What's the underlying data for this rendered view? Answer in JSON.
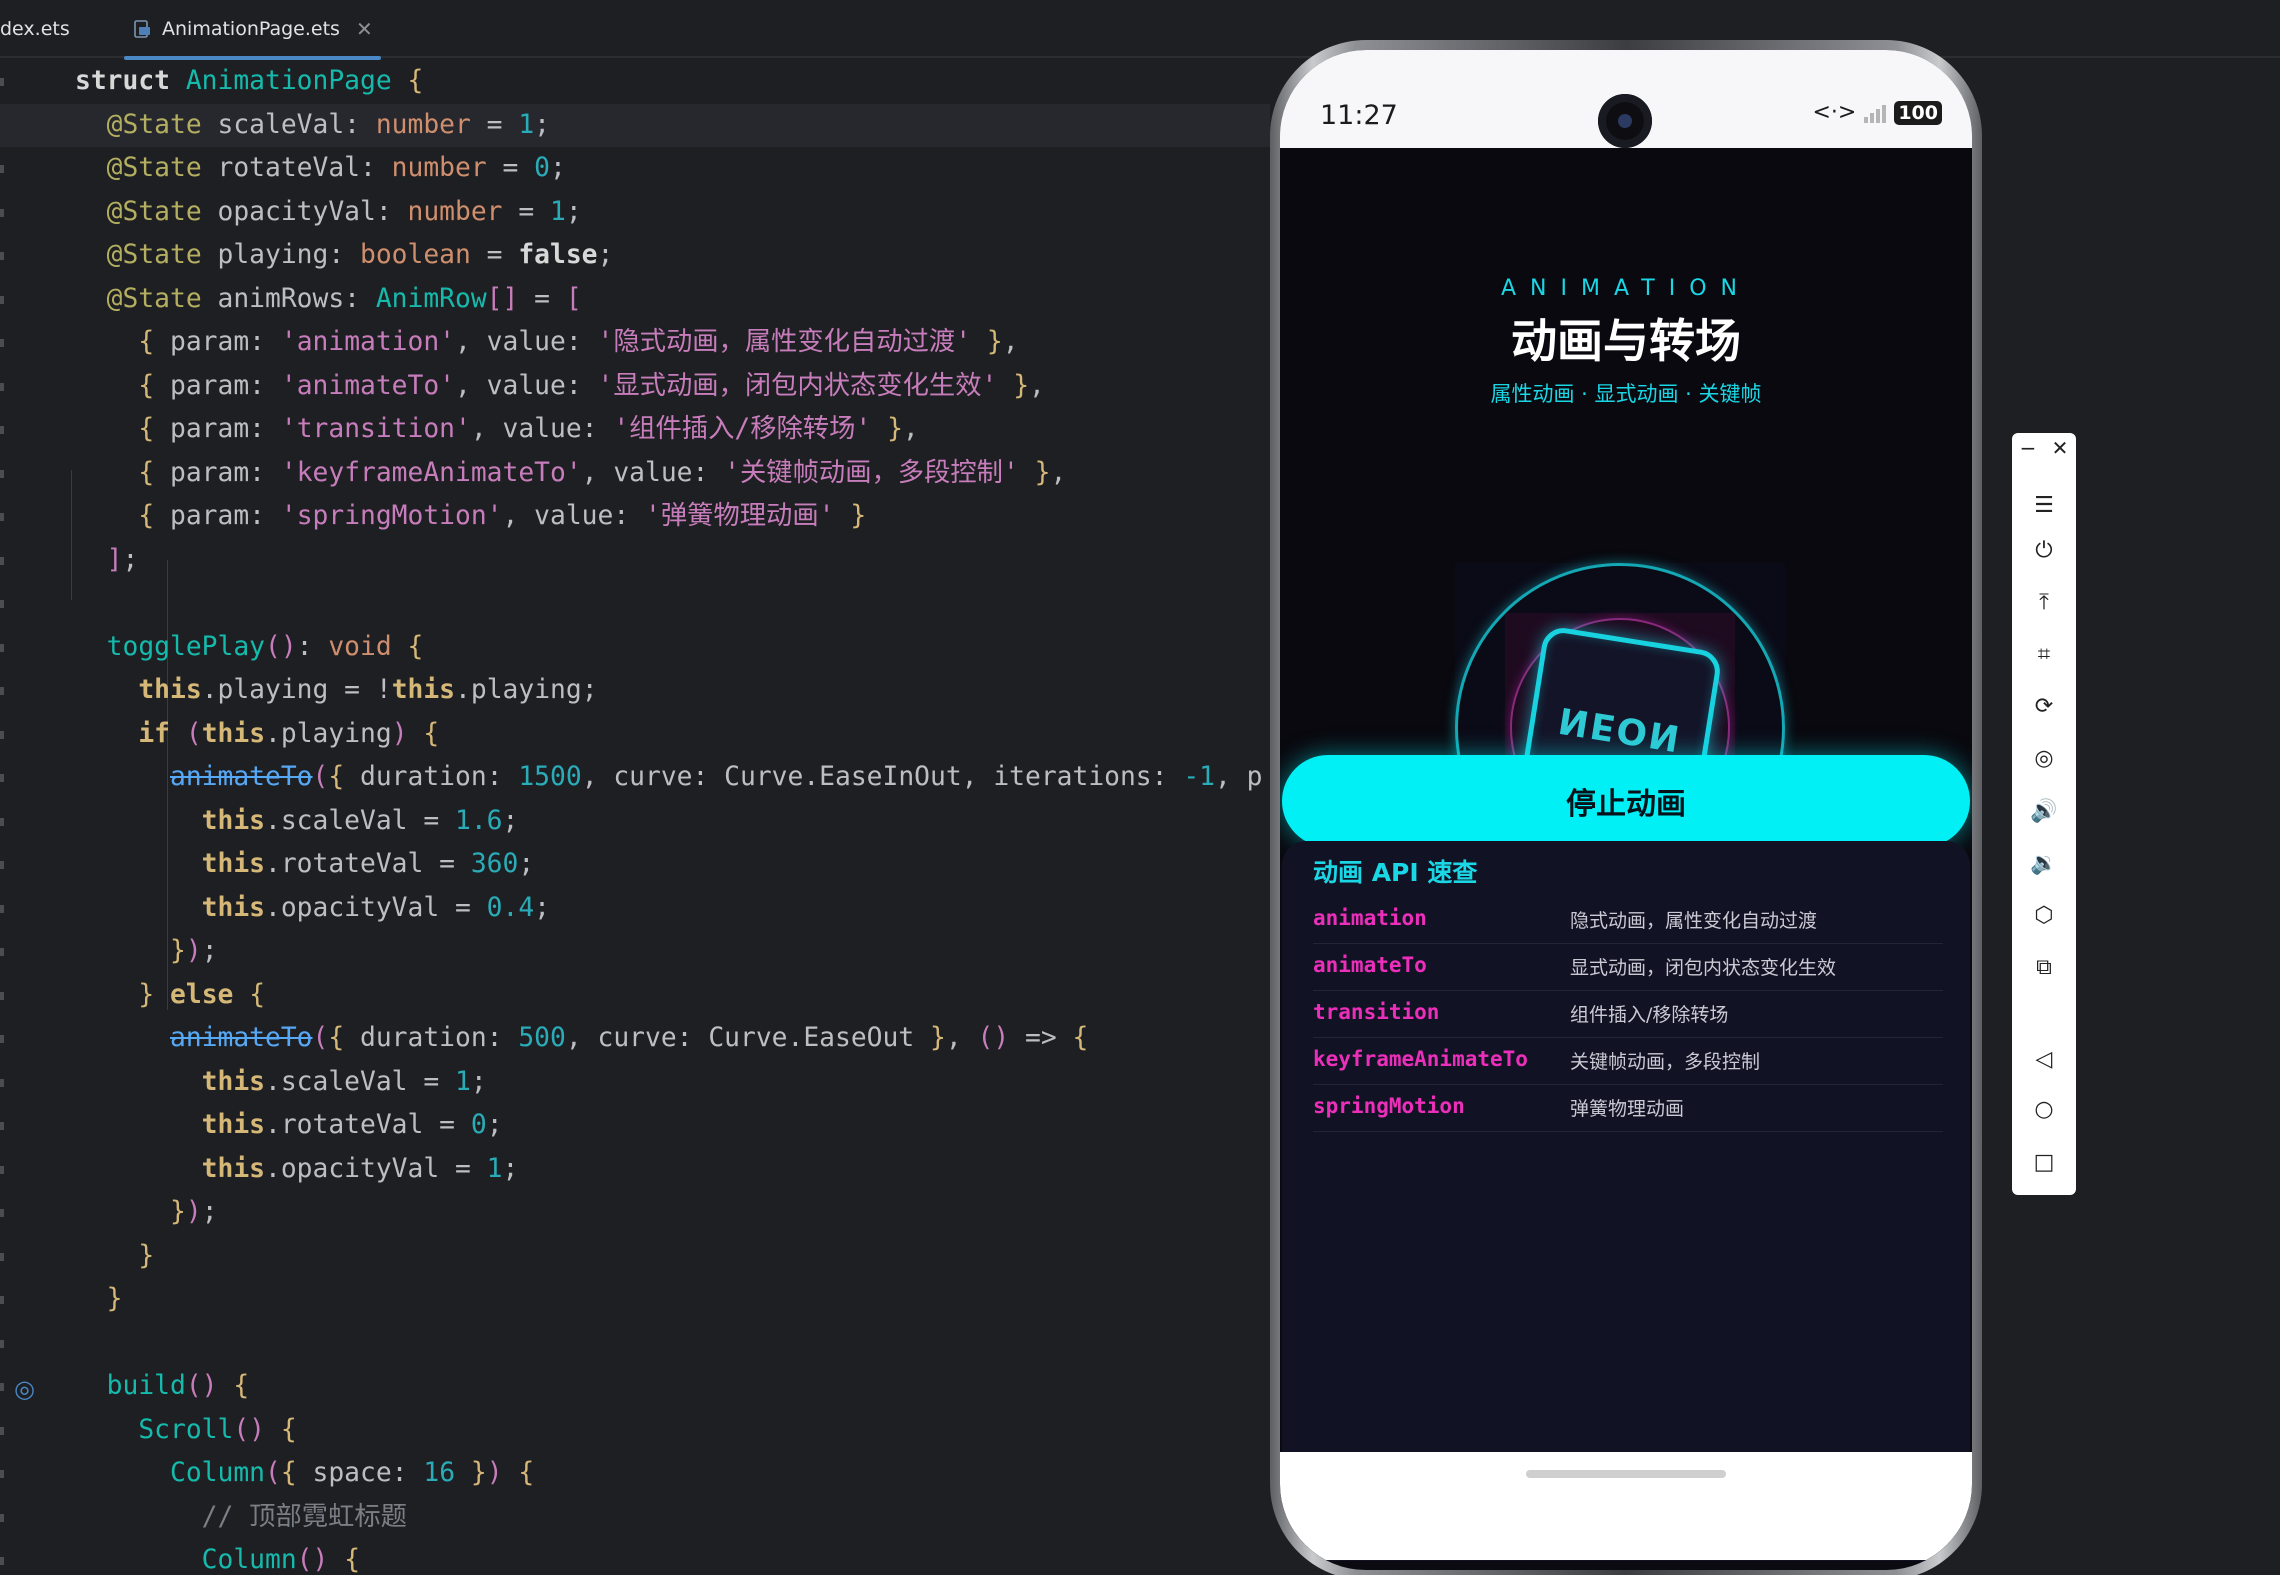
{
  "tabs": [
    {
      "label": "dex.ets",
      "active": false
    },
    {
      "label": "AnimationPage.ets",
      "active": true
    }
  ],
  "code": {
    "lines": [
      {
        "spans": [
          [
            "sw",
            "struct "
          ],
          [
            "cl",
            "AnimationPage "
          ],
          [
            "brk1",
            "{"
          ]
        ]
      },
      {
        "spans": [
          [
            "txt",
            "  "
          ],
          [
            "ann",
            "@State "
          ],
          [
            "txt",
            "scaleVal: "
          ],
          [
            "kw",
            "number"
          ],
          [
            "txt",
            " = "
          ],
          [
            "num",
            "1"
          ],
          [
            "txt",
            ";"
          ]
        ],
        "active": true
      },
      {
        "spans": [
          [
            "txt",
            "  "
          ],
          [
            "ann",
            "@State "
          ],
          [
            "txt",
            "rotateVal: "
          ],
          [
            "kw",
            "number"
          ],
          [
            "txt",
            " = "
          ],
          [
            "num",
            "0"
          ],
          [
            "txt",
            ";"
          ]
        ]
      },
      {
        "spans": [
          [
            "txt",
            "  "
          ],
          [
            "ann",
            "@State "
          ],
          [
            "txt",
            "opacityVal: "
          ],
          [
            "kw",
            "number"
          ],
          [
            "txt",
            " = "
          ],
          [
            "num",
            "1"
          ],
          [
            "txt",
            ";"
          ]
        ]
      },
      {
        "spans": [
          [
            "txt",
            "  "
          ],
          [
            "ann",
            "@State "
          ],
          [
            "txt",
            "playing: "
          ],
          [
            "kw",
            "boolean"
          ],
          [
            "txt",
            " = "
          ],
          [
            "sw",
            "false"
          ],
          [
            "txt",
            ";"
          ]
        ]
      },
      {
        "spans": [
          [
            "txt",
            "  "
          ],
          [
            "ann",
            "@State "
          ],
          [
            "txt",
            "animRows: "
          ],
          [
            "cl",
            "AnimRow"
          ],
          [
            "brk2",
            "[]"
          ],
          [
            "txt",
            " = "
          ],
          [
            "brk2",
            "["
          ]
        ]
      },
      {
        "spans": [
          [
            "txt",
            "    "
          ],
          [
            "brk1",
            "{"
          ],
          [
            "txt",
            " param: "
          ],
          [
            "str",
            "'animation'"
          ],
          [
            "txt",
            ", value: "
          ],
          [
            "str",
            "'隐式动画，属性变化自动过渡'"
          ],
          [
            "txt",
            " "
          ],
          [
            "brk1",
            "}"
          ],
          [
            "txt",
            ","
          ]
        ]
      },
      {
        "spans": [
          [
            "txt",
            "    "
          ],
          [
            "brk1",
            "{"
          ],
          [
            "txt",
            " param: "
          ],
          [
            "str",
            "'animateTo'"
          ],
          [
            "txt",
            ", value: "
          ],
          [
            "str",
            "'显式动画，闭包内状态变化生效'"
          ],
          [
            "txt",
            " "
          ],
          [
            "brk1",
            "}"
          ],
          [
            "txt",
            ","
          ]
        ]
      },
      {
        "spans": [
          [
            "txt",
            "    "
          ],
          [
            "brk1",
            "{"
          ],
          [
            "txt",
            " param: "
          ],
          [
            "str",
            "'transition'"
          ],
          [
            "txt",
            ", value: "
          ],
          [
            "str",
            "'组件插入/移除转场'"
          ],
          [
            "txt",
            " "
          ],
          [
            "brk1",
            "}"
          ],
          [
            "txt",
            ","
          ]
        ]
      },
      {
        "spans": [
          [
            "txt",
            "    "
          ],
          [
            "brk1",
            "{"
          ],
          [
            "txt",
            " param: "
          ],
          [
            "str",
            "'keyframeAnimateTo'"
          ],
          [
            "txt",
            ", value: "
          ],
          [
            "str",
            "'关键帧动画，多段控制'"
          ],
          [
            "txt",
            " "
          ],
          [
            "brk1",
            "}"
          ],
          [
            "txt",
            ","
          ]
        ]
      },
      {
        "spans": [
          [
            "txt",
            "    "
          ],
          [
            "brk1",
            "{"
          ],
          [
            "txt",
            " param: "
          ],
          [
            "str",
            "'springMotion'"
          ],
          [
            "txt",
            ", value: "
          ],
          [
            "str",
            "'弹簧物理动画'"
          ],
          [
            "txt",
            " "
          ],
          [
            "brk1",
            "}"
          ]
        ]
      },
      {
        "spans": [
          [
            "txt",
            "  "
          ],
          [
            "brk2",
            "]"
          ],
          [
            "txt",
            ";"
          ]
        ]
      },
      {
        "spans": [
          [
            "txt",
            ""
          ]
        ]
      },
      {
        "spans": [
          [
            "txt",
            "  "
          ],
          [
            "cl",
            "togglePlay"
          ],
          [
            "brk2",
            "()"
          ],
          [
            "txt",
            ": "
          ],
          [
            "kw",
            "void"
          ],
          [
            "txt",
            " "
          ],
          [
            "brk1",
            "{"
          ]
        ]
      },
      {
        "spans": [
          [
            "txt",
            "    "
          ],
          [
            "th",
            "this"
          ],
          [
            "txt",
            ".playing = !"
          ],
          [
            "th",
            "this"
          ],
          [
            "txt",
            ".playing;"
          ]
        ]
      },
      {
        "spans": [
          [
            "txt",
            "    "
          ],
          [
            "th",
            "if"
          ],
          [
            "txt",
            " "
          ],
          [
            "brk2",
            "("
          ],
          [
            "th",
            "this"
          ],
          [
            "txt",
            ".playing"
          ],
          [
            "brk2",
            ")"
          ],
          [
            "txt",
            " "
          ],
          [
            "brk1",
            "{"
          ]
        ]
      },
      {
        "spans": [
          [
            "txt",
            "      "
          ],
          [
            "dep",
            "animateTo"
          ],
          [
            "brk2",
            "("
          ],
          [
            "brk1",
            "{"
          ],
          [
            "txt",
            " duration: "
          ],
          [
            "num",
            "1500"
          ],
          [
            "txt",
            ", curve: Curve.EaseInOut, iterations: "
          ],
          [
            "num",
            "-1"
          ],
          [
            "txt",
            ", p"
          ]
        ]
      },
      {
        "spans": [
          [
            "txt",
            "        "
          ],
          [
            "th",
            "this"
          ],
          [
            "txt",
            ".scaleVal = "
          ],
          [
            "num",
            "1.6"
          ],
          [
            "txt",
            ";"
          ]
        ]
      },
      {
        "spans": [
          [
            "txt",
            "        "
          ],
          [
            "th",
            "this"
          ],
          [
            "txt",
            ".rotateVal = "
          ],
          [
            "num",
            "360"
          ],
          [
            "txt",
            ";"
          ]
        ]
      },
      {
        "spans": [
          [
            "txt",
            "        "
          ],
          [
            "th",
            "this"
          ],
          [
            "txt",
            ".opacityVal = "
          ],
          [
            "num",
            "0.4"
          ],
          [
            "txt",
            ";"
          ]
        ]
      },
      {
        "spans": [
          [
            "txt",
            "      "
          ],
          [
            "brk1",
            "}"
          ],
          [
            "brk2",
            ")"
          ],
          [
            "txt",
            ";"
          ]
        ]
      },
      {
        "spans": [
          [
            "txt",
            "    "
          ],
          [
            "brk1",
            "}"
          ],
          [
            "txt",
            " "
          ],
          [
            "th",
            "else"
          ],
          [
            "txt",
            " "
          ],
          [
            "brk1",
            "{"
          ]
        ]
      },
      {
        "spans": [
          [
            "txt",
            "      "
          ],
          [
            "dep",
            "animateTo"
          ],
          [
            "brk2",
            "("
          ],
          [
            "brk1",
            "{"
          ],
          [
            "txt",
            " duration: "
          ],
          [
            "num",
            "500"
          ],
          [
            "txt",
            ", curve: Curve.EaseOut "
          ],
          [
            "brk1",
            "}"
          ],
          [
            "txt",
            ", "
          ],
          [
            "brk2",
            "()"
          ],
          [
            "txt",
            " => "
          ],
          [
            "brk1",
            "{"
          ]
        ]
      },
      {
        "spans": [
          [
            "txt",
            "        "
          ],
          [
            "th",
            "this"
          ],
          [
            "txt",
            ".scaleVal = "
          ],
          [
            "num",
            "1"
          ],
          [
            "txt",
            ";"
          ]
        ]
      },
      {
        "spans": [
          [
            "txt",
            "        "
          ],
          [
            "th",
            "this"
          ],
          [
            "txt",
            ".rotateVal = "
          ],
          [
            "num",
            "0"
          ],
          [
            "txt",
            ";"
          ]
        ]
      },
      {
        "spans": [
          [
            "txt",
            "        "
          ],
          [
            "th",
            "this"
          ],
          [
            "txt",
            ".opacityVal = "
          ],
          [
            "num",
            "1"
          ],
          [
            "txt",
            ";"
          ]
        ]
      },
      {
        "spans": [
          [
            "txt",
            "      "
          ],
          [
            "brk1",
            "}"
          ],
          [
            "brk2",
            ")"
          ],
          [
            "txt",
            ";"
          ]
        ]
      },
      {
        "spans": [
          [
            "txt",
            "    "
          ],
          [
            "brk1",
            "}"
          ]
        ]
      },
      {
        "spans": [
          [
            "txt",
            "  "
          ],
          [
            "brk1",
            "}"
          ]
        ]
      },
      {
        "spans": [
          [
            "txt",
            ""
          ]
        ]
      },
      {
        "spans": [
          [
            "txt",
            "  "
          ],
          [
            "cl",
            "build"
          ],
          [
            "brk2",
            "()"
          ],
          [
            "txt",
            " "
          ],
          [
            "brk1",
            "{"
          ]
        ]
      },
      {
        "spans": [
          [
            "txt",
            "    "
          ],
          [
            "cl",
            "Scroll"
          ],
          [
            "brk2",
            "()"
          ],
          [
            "txt",
            " "
          ],
          [
            "brk1",
            "{"
          ]
        ]
      },
      {
        "spans": [
          [
            "txt",
            "      "
          ],
          [
            "cl",
            "Column"
          ],
          [
            "brk2",
            "("
          ],
          [
            "brk1",
            "{"
          ],
          [
            "txt",
            " space: "
          ],
          [
            "num",
            "16"
          ],
          [
            "txt",
            " "
          ],
          [
            "brk1",
            "}"
          ],
          [
            "brk2",
            ")"
          ],
          [
            "txt",
            " "
          ],
          [
            "brk1",
            "{"
          ]
        ]
      },
      {
        "spans": [
          [
            "txt",
            "        "
          ],
          [
            "cmt",
            "// 顶部霓虹标题"
          ]
        ]
      },
      {
        "spans": [
          [
            "txt",
            "        "
          ],
          [
            "cl",
            "Column"
          ],
          [
            "brk2",
            "()"
          ],
          [
            "txt",
            " "
          ],
          [
            "brk1",
            "{"
          ]
        ]
      }
    ]
  },
  "device": {
    "time": "11:27",
    "battery": "100",
    "net": "<·>",
    "app": {
      "eyebrow": "ANIMATION",
      "title": "动画与转场",
      "subtitle": "属性动画 · 显式动画 · 关键帧",
      "neon_word": "NEON",
      "stop_button": "停止动画",
      "api_header": "动画 API 速查",
      "api_rows": [
        {
          "param": "animation",
          "value": "隐式动画，属性变化自动过渡"
        },
        {
          "param": "animateTo",
          "value": "显式动画，闭包内状态变化生效"
        },
        {
          "param": "transition",
          "value": "组件插入/移除转场"
        },
        {
          "param": "keyframeAnimateTo",
          "value": "关键帧动画，多段控制"
        },
        {
          "param": "springMotion",
          "value": "弹簧物理动画"
        }
      ]
    }
  },
  "toolbar": {
    "min": "−",
    "close": "✕",
    "buttons": [
      {
        "name": "menu",
        "glyph": "☰"
      },
      {
        "name": "power",
        "glyph": "⏻"
      },
      {
        "name": "top",
        "glyph": "⤒"
      },
      {
        "name": "crop",
        "glyph": "⌗"
      },
      {
        "name": "rotate",
        "glyph": "⟳"
      },
      {
        "name": "record",
        "glyph": "◎"
      },
      {
        "name": "volume-up",
        "glyph": "🔊"
      },
      {
        "name": "volume-down",
        "glyph": "🔉"
      },
      {
        "name": "shake",
        "glyph": "⬡"
      },
      {
        "name": "multi-screen",
        "glyph": "⧉"
      },
      {
        "name": "back",
        "glyph": "◁"
      },
      {
        "name": "home",
        "glyph": "○"
      },
      {
        "name": "recents",
        "glyph": "□"
      }
    ]
  },
  "colors": {
    "accent_cyan": "#00f0f5",
    "accent_pink": "#ec2fba",
    "editor_bg": "#1e1f22",
    "app_bg": "#09090f"
  }
}
